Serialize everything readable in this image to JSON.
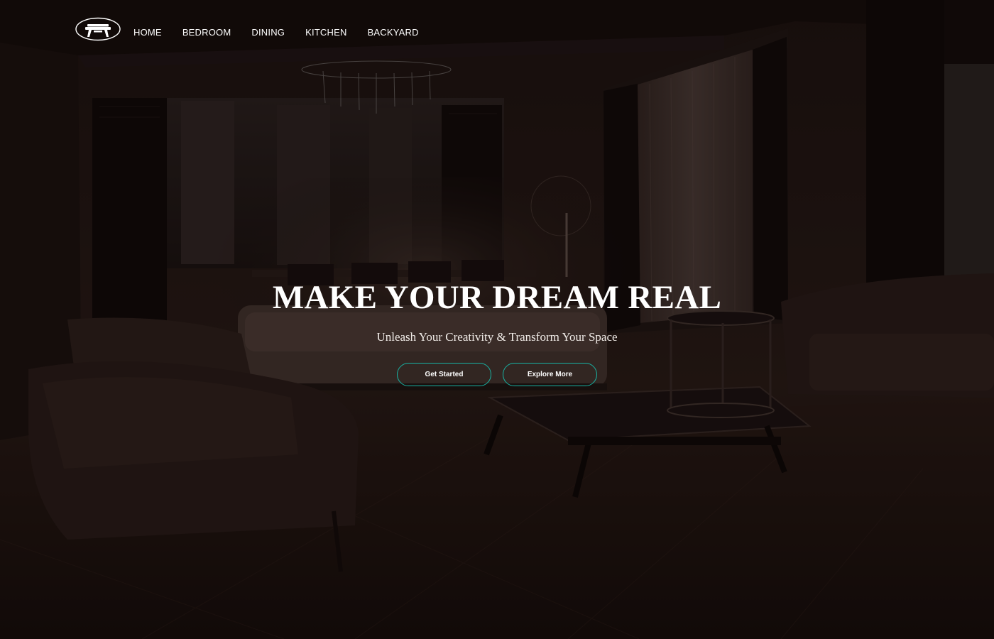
{
  "nav": {
    "logo_icon": "table-icon",
    "items": [
      {
        "label": "HOME"
      },
      {
        "label": "BEDROOM"
      },
      {
        "label": "DINING"
      },
      {
        "label": "KITCHEN"
      },
      {
        "label": "BACKYARD"
      }
    ]
  },
  "hero": {
    "title": "MAKE YOUR DREAM REAL",
    "subtitle": "Unleash Your Creativity & Transform Your Space",
    "primary_button": "Get Started",
    "secondary_button": "Explore More"
  },
  "colors": {
    "button_border": "#18b3a4",
    "text": "#ffffff",
    "background": "#120c0a"
  }
}
